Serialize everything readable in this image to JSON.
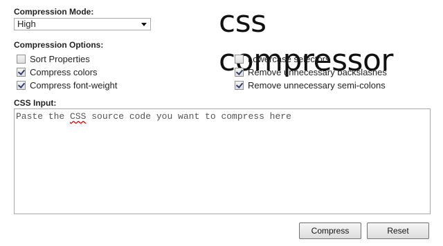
{
  "mode": {
    "label": "Compression Mode:",
    "selected": "High"
  },
  "logo": "css compressor",
  "options": {
    "label": "Compression Options:",
    "left": [
      {
        "label": "Sort Properties",
        "checked": false
      },
      {
        "label": "Compress colors",
        "checked": true
      },
      {
        "label": "Compress font-weight",
        "checked": true
      }
    ],
    "right": [
      {
        "label": "Lowercase selectors",
        "checked": false
      },
      {
        "label": "Remove unnecessary backslashes",
        "checked": true
      },
      {
        "label": "Remove unnecessary semi-colons",
        "checked": true
      }
    ]
  },
  "input": {
    "label": "CSS Input:",
    "placeholder_before": "Paste the ",
    "placeholder_css": "CSS",
    "placeholder_after": " source code you want to compress here"
  },
  "buttons": {
    "compress": "Compress",
    "reset": "Reset"
  }
}
